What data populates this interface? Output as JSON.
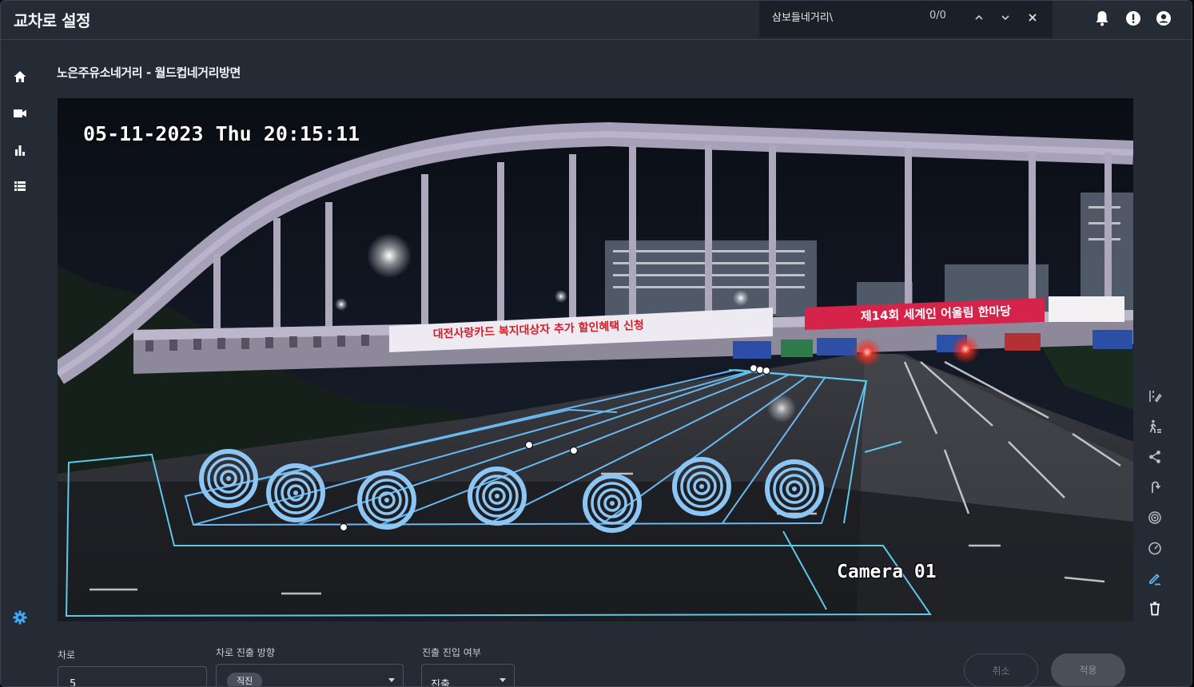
{
  "app": {
    "title": "교차로 설정"
  },
  "search": {
    "query": "삼보들네거리\\",
    "count": "0/0"
  },
  "icons": {
    "search_prev": "chevron-up-icon",
    "search_next": "chevron-down-icon",
    "search_close": "close-icon",
    "notifications": "bell-icon",
    "alert": "alert-circle-icon",
    "account": "account-circle-icon"
  },
  "nav": [
    {
      "id": "home",
      "icon": "home-icon"
    },
    {
      "id": "camera",
      "icon": "videocam-icon"
    },
    {
      "id": "stats",
      "icon": "bar-chart-icon"
    },
    {
      "id": "list",
      "icon": "list-icon"
    },
    {
      "id": "settings",
      "icon": "gear-icon"
    }
  ],
  "page": {
    "title": "노은주유소네거리 - 월드컵네거리방면"
  },
  "camera": {
    "timestamp": "05-11-2023 Thu 20:15:11",
    "label": "Camera 01",
    "overlay_color": "#5ec8ea",
    "marker_color": "#8cc6f5",
    "banner_left": "대전사랑카드 복지대상자 추가 할인혜택 신청",
    "banner_right": "제14회 세계인 어울림 한마당"
  },
  "tools": [
    {
      "id": "lane",
      "icon": "lane-tool-icon"
    },
    {
      "id": "pedestrian",
      "icon": "pedestrian-icon"
    },
    {
      "id": "share",
      "icon": "share-node-icon"
    },
    {
      "id": "turn",
      "icon": "turn-arrow-icon"
    },
    {
      "id": "target",
      "icon": "target-icon"
    },
    {
      "id": "speed",
      "icon": "speed-gauge-icon"
    },
    {
      "id": "draw",
      "icon": "pencil-icon",
      "active": true,
      "active_color": "#5ab8f5"
    },
    {
      "id": "delete",
      "icon": "trash-icon"
    }
  ],
  "form": {
    "lane_label": "차로",
    "lane_value": "5",
    "direction_label": "차로 진출 방향",
    "direction_value": "직진",
    "entry_label": "진출 진입 여부",
    "entry_value": "진출",
    "cancel_label": "취소",
    "apply_label": "적용"
  }
}
